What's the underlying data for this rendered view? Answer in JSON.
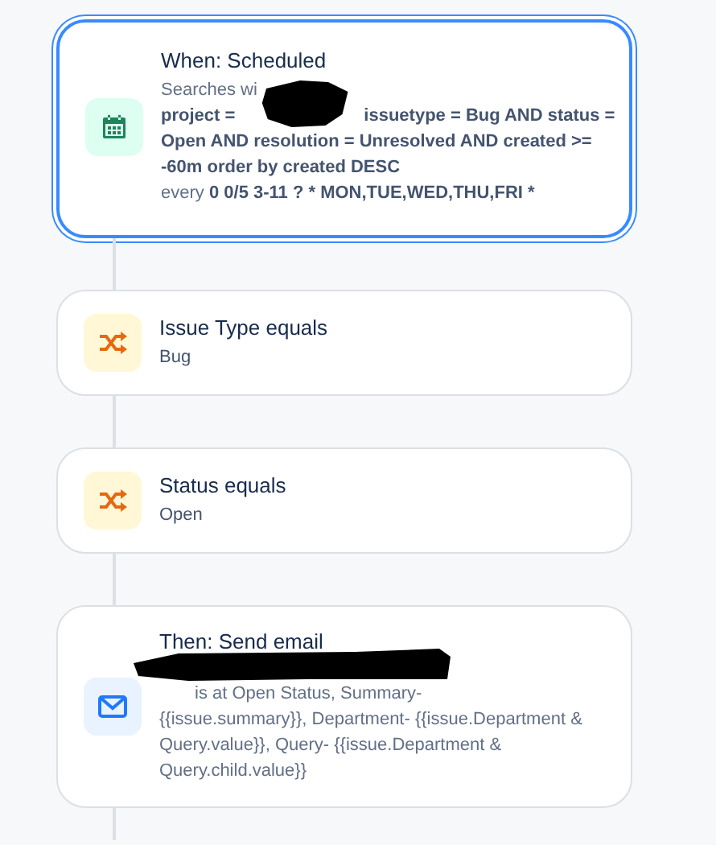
{
  "steps": [
    {
      "kind": "trigger",
      "selected": true,
      "title": "When: Scheduled",
      "search_label": "Searches wi",
      "query_lines": [
        "project =",
        "issuetype = Bug AND status =",
        "Open AND resolution = Unresolved AND created >=",
        "-60m order by created DESC"
      ],
      "schedule_label": "every",
      "schedule": "0 0/5 3-11 ? * MON,TUE,WED,THU,FRI *"
    },
    {
      "kind": "condition",
      "selected": false,
      "title": "Issue Type equals",
      "value": "Bug"
    },
    {
      "kind": "condition",
      "selected": false,
      "title": "Status equals",
      "value": "Open"
    },
    {
      "kind": "action",
      "selected": false,
      "title": "Then: Send email",
      "body_lines": [
        "is at Open Status, Summary-",
        "{{issue.summary}}, Department- {{issue.Department & Query.value}}, Query- {{issue.Department & Query.child.value}}"
      ]
    }
  ]
}
